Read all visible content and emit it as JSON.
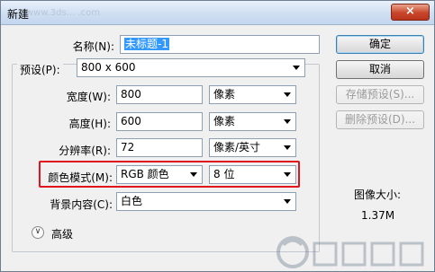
{
  "window": {
    "title": "新建",
    "watermark": "www.3ds... .com",
    "close_symbol": "×"
  },
  "fields": {
    "name_label": "名称(N):",
    "name_value": "未标题-1",
    "preset_label": "预设(P):",
    "preset_value": "800 x 600",
    "width_label": "宽度(W):",
    "width_value": "800",
    "width_unit": "像素",
    "height_label": "高度(H):",
    "height_value": "600",
    "height_unit": "像素",
    "resolution_label": "分辨率(R):",
    "resolution_value": "72",
    "resolution_unit": "像素/英寸",
    "color_mode_label": "颜色模式(M):",
    "color_mode_value": "RGB 颜色",
    "bit_depth_value": "8 位",
    "background_label": "背景内容(C):",
    "background_value": "白色",
    "advanced_label": "高级"
  },
  "buttons": {
    "ok": "确定",
    "cancel": "取消",
    "save_preset": "存储预设(S)...",
    "delete_preset": "删除预设(D)..."
  },
  "image_size": {
    "label": "图像大小:",
    "value": "1.37M"
  },
  "colors": {
    "highlight": "#e0151b",
    "selection": "#3399ff"
  }
}
